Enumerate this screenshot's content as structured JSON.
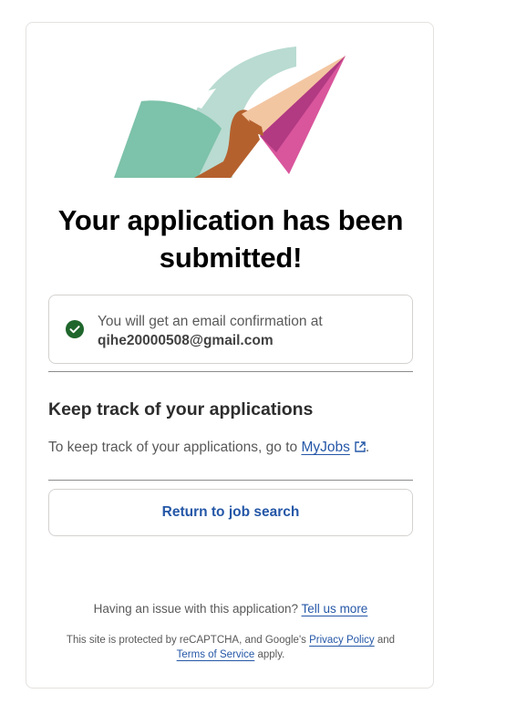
{
  "confirmation": {
    "title_line1": "Your application has been",
    "title_line2": "submitted!",
    "email_notice": "You will get an email confirmation at",
    "email": "qihe20000508@gmail.com"
  },
  "tracking": {
    "heading": "Keep track of your applications",
    "text_before": "To keep track of your applications, go to ",
    "link_label": "MyJobs",
    "text_after": "."
  },
  "actions": {
    "return_label": "Return to job search"
  },
  "footer": {
    "issue_text": "Having an issue with this application? ",
    "issue_link": "Tell us more",
    "recaptcha_text": "This site is protected by reCAPTCHA, and Google's ",
    "privacy_link": "Privacy Policy",
    "and_text": " and",
    "terms_link": "Terms of Service",
    "apply_text": " apply."
  },
  "icons": {
    "check": "check-circle-icon",
    "external": "external-link-icon"
  },
  "colors": {
    "accent_blue": "#2557a7",
    "success_green": "#1f662c",
    "illustration_teal": "#7dc2aa",
    "paper_plane_pink": "#d9559c"
  }
}
